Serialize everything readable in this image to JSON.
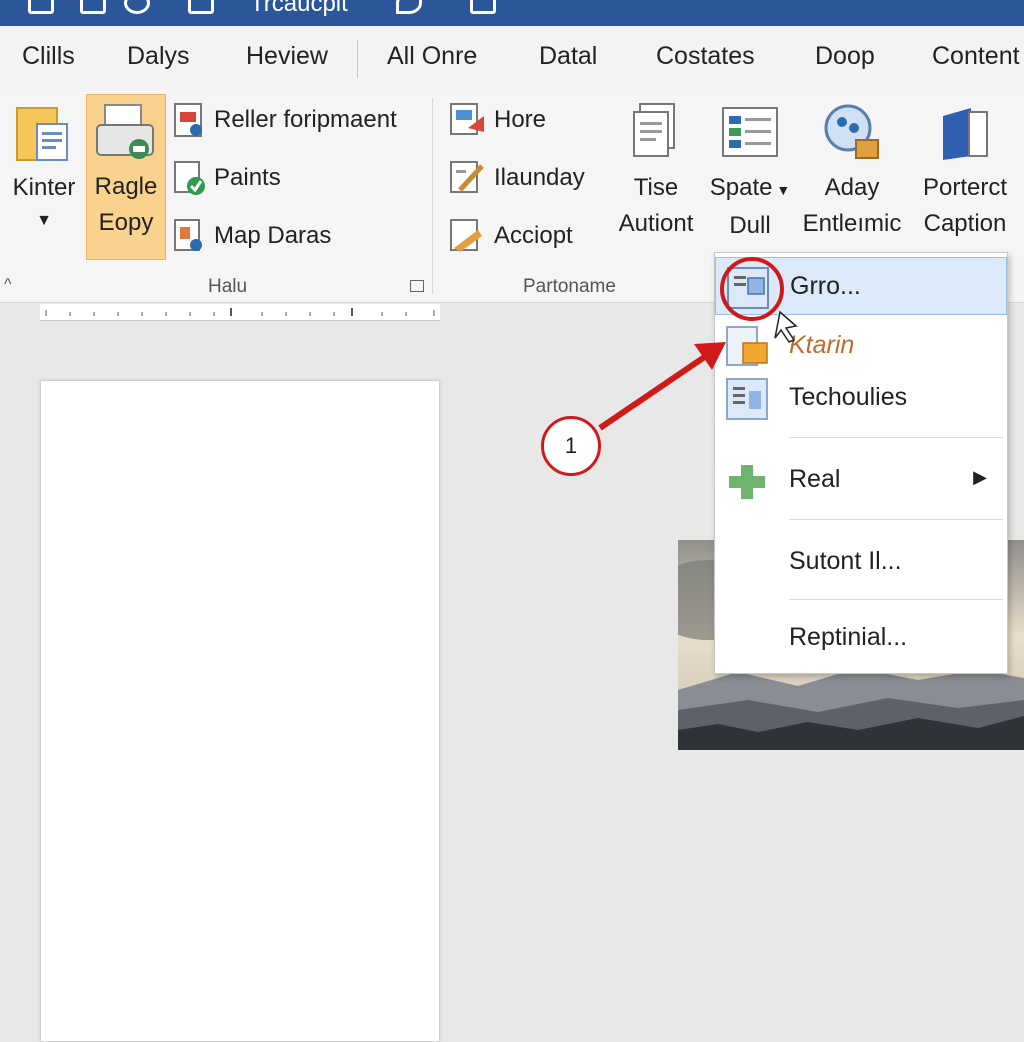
{
  "window": {
    "title": "Trcaucpit"
  },
  "tabs": [
    "Clills",
    "Dalys",
    "Heview",
    "All Onre",
    "Datal",
    "Costates",
    "Doop",
    "Content"
  ],
  "ribbon": {
    "groups": [
      {
        "label": "Halu"
      },
      {
        "label": "Partoname"
      }
    ],
    "buttons": {
      "kinter": "Kinter",
      "ragle_line1": "Ragle",
      "ragle_line2": "Eopy",
      "reller": "Reller foripmaent",
      "paints": "Paints",
      "map_daras": "Map Daras",
      "hore": "Hore",
      "ilaunday": "Ilaunday",
      "acciopt": "Acciopt",
      "tise_line1": "Tise",
      "tise_line2": "Autiont",
      "spate_line1": "Spate",
      "spate_line2": "Dull",
      "aday_line1": "Aday",
      "aday_line2": "Entleımic",
      "porterct_line1": "Porterct",
      "porterct_line2": "Caption"
    }
  },
  "dropdown": {
    "items": [
      {
        "label": "Grro...",
        "icon": "document-table-icon",
        "highlighted": true
      },
      {
        "label": "Ktarin",
        "icon": "document-folder-icon"
      },
      {
        "label": "Techoulies",
        "icon": "document-grid-icon"
      },
      {
        "label": "Real",
        "icon": "plus-icon",
        "has_submenu": true
      },
      {
        "label": "Sutont Il..."
      },
      {
        "label": "Reptinial..."
      }
    ]
  },
  "annotation": {
    "step_number": "1"
  },
  "colors": {
    "titlebar": "#2b579a",
    "selected_button": "#f9d38e",
    "highlight": "#dce9f8",
    "annotation_red": "#d01a1a"
  }
}
